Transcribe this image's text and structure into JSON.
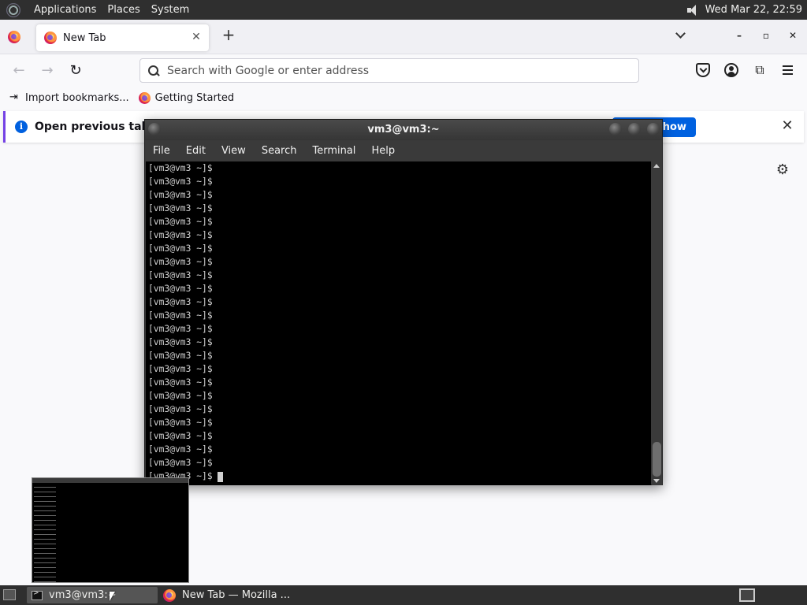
{
  "top_panel": {
    "menus": [
      "Applications",
      "Places",
      "System"
    ],
    "clock": "Wed Mar 22, 22:59"
  },
  "firefox": {
    "tab": {
      "title": "New Tab",
      "close": "✕"
    },
    "new_tab": "+",
    "window_controls": [
      "–",
      "▫",
      "✕"
    ],
    "urlbar": {
      "placeholder": "Search with Google or enter address"
    },
    "bookmarks": [
      {
        "label": "Import bookmarks...",
        "icon": "import-icon"
      },
      {
        "label": "Getting Started",
        "icon": "firefox-icon"
      }
    ],
    "notification": {
      "text": "Open previous tabs?",
      "button": "how",
      "close": "✕"
    },
    "accent": "#7542e5",
    "button_color": "#0061e0"
  },
  "terminal": {
    "title": "vm3@vm3:~",
    "menu": [
      "File",
      "Edit",
      "View",
      "Search",
      "Terminal",
      "Help"
    ],
    "lines": [
      "[vm3@vm3 ~]$",
      "[vm3@vm3 ~]$",
      "[vm3@vm3 ~]$",
      "[vm3@vm3 ~]$",
      "[vm3@vm3 ~]$",
      "[vm3@vm3 ~]$",
      "[vm3@vm3 ~]$",
      "[vm3@vm3 ~]$",
      "[vm3@vm3 ~]$",
      "[vm3@vm3 ~]$",
      "[vm3@vm3 ~]$",
      "[vm3@vm3 ~]$",
      "[vm3@vm3 ~]$",
      "[vm3@vm3 ~]$",
      "[vm3@vm3 ~]$",
      "[vm3@vm3 ~]$",
      "[vm3@vm3 ~]$",
      "[vm3@vm3 ~]$",
      "[vm3@vm3 ~]$",
      "[vm3@vm3 ~]$",
      "[vm3@vm3 ~]$",
      "[vm3@vm3 ~]$",
      "[vm3@vm3 ~]$",
      "[vm3@vm3 ~]$"
    ]
  },
  "taskbar": {
    "items": [
      {
        "label": "vm3@vm3:~",
        "icon": "terminal-icon"
      },
      {
        "label": "New Tab — Mozilla ...",
        "icon": "firefox-icon"
      }
    ]
  }
}
